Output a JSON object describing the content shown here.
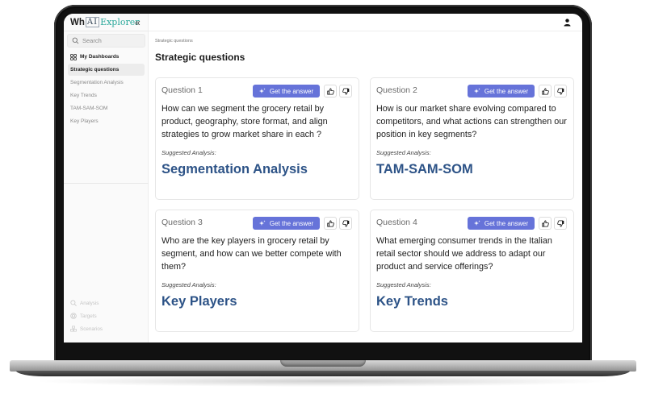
{
  "app": {
    "logo_prefix": "Wh",
    "logo_ai": "AI",
    "logo_suffix": "Explorer",
    "collapse_icon": "chevrons-left-icon",
    "user_icon": "user-icon"
  },
  "sidebar": {
    "search": {
      "placeholder": "Search",
      "value": ""
    },
    "dashboards_label": "My Dashboards",
    "items": [
      {
        "label": "Strategic questions",
        "active": true
      },
      {
        "label": "Segmentation Analysis",
        "active": false
      },
      {
        "label": "Key Trends",
        "active": false
      },
      {
        "label": "TAM-SAM-SOM",
        "active": false
      },
      {
        "label": "Key Players",
        "active": false
      }
    ],
    "tools": [
      {
        "label": "Analysis",
        "icon": "search-analysis-icon"
      },
      {
        "label": "Targets",
        "icon": "target-icon"
      },
      {
        "label": "Scenarios",
        "icon": "scenarios-icon"
      }
    ]
  },
  "main": {
    "breadcrumb": "Strategic questions",
    "title": "Strategic questions",
    "cards": [
      {
        "label": "Question 1",
        "button": "Get the answer",
        "question": "How can we segment the grocery retail by product, geography, store format, and align strategies to grow market share in each ?",
        "suggested_label": "Suggested Analysis:",
        "suggested": "Segmentation Analysis"
      },
      {
        "label": "Question 2",
        "button": "Get the answer",
        "question": "How is our market share evolving compared to competitors, and what actions can strengthen our position in key segments?",
        "suggested_label": "Suggested Analysis:",
        "suggested": "TAM-SAM-SOM"
      },
      {
        "label": "Question 3",
        "button": "Get the answer",
        "question": "Who are the key players in grocery retail by segment, and how can we better compete with them?",
        "suggested_label": "Suggested Analysis:",
        "suggested": "Key Players"
      },
      {
        "label": "Question 4",
        "button": "Get the answer",
        "question": "What emerging consumer trends in the Italian retail sector should we address to adapt our product and service offerings?",
        "suggested_label": "Suggested Analysis:",
        "suggested": "Key Trends"
      }
    ]
  },
  "colors": {
    "accent": "#6673d9",
    "suggested_title": "#2d5387",
    "logo_teal": "#2aa89a"
  }
}
